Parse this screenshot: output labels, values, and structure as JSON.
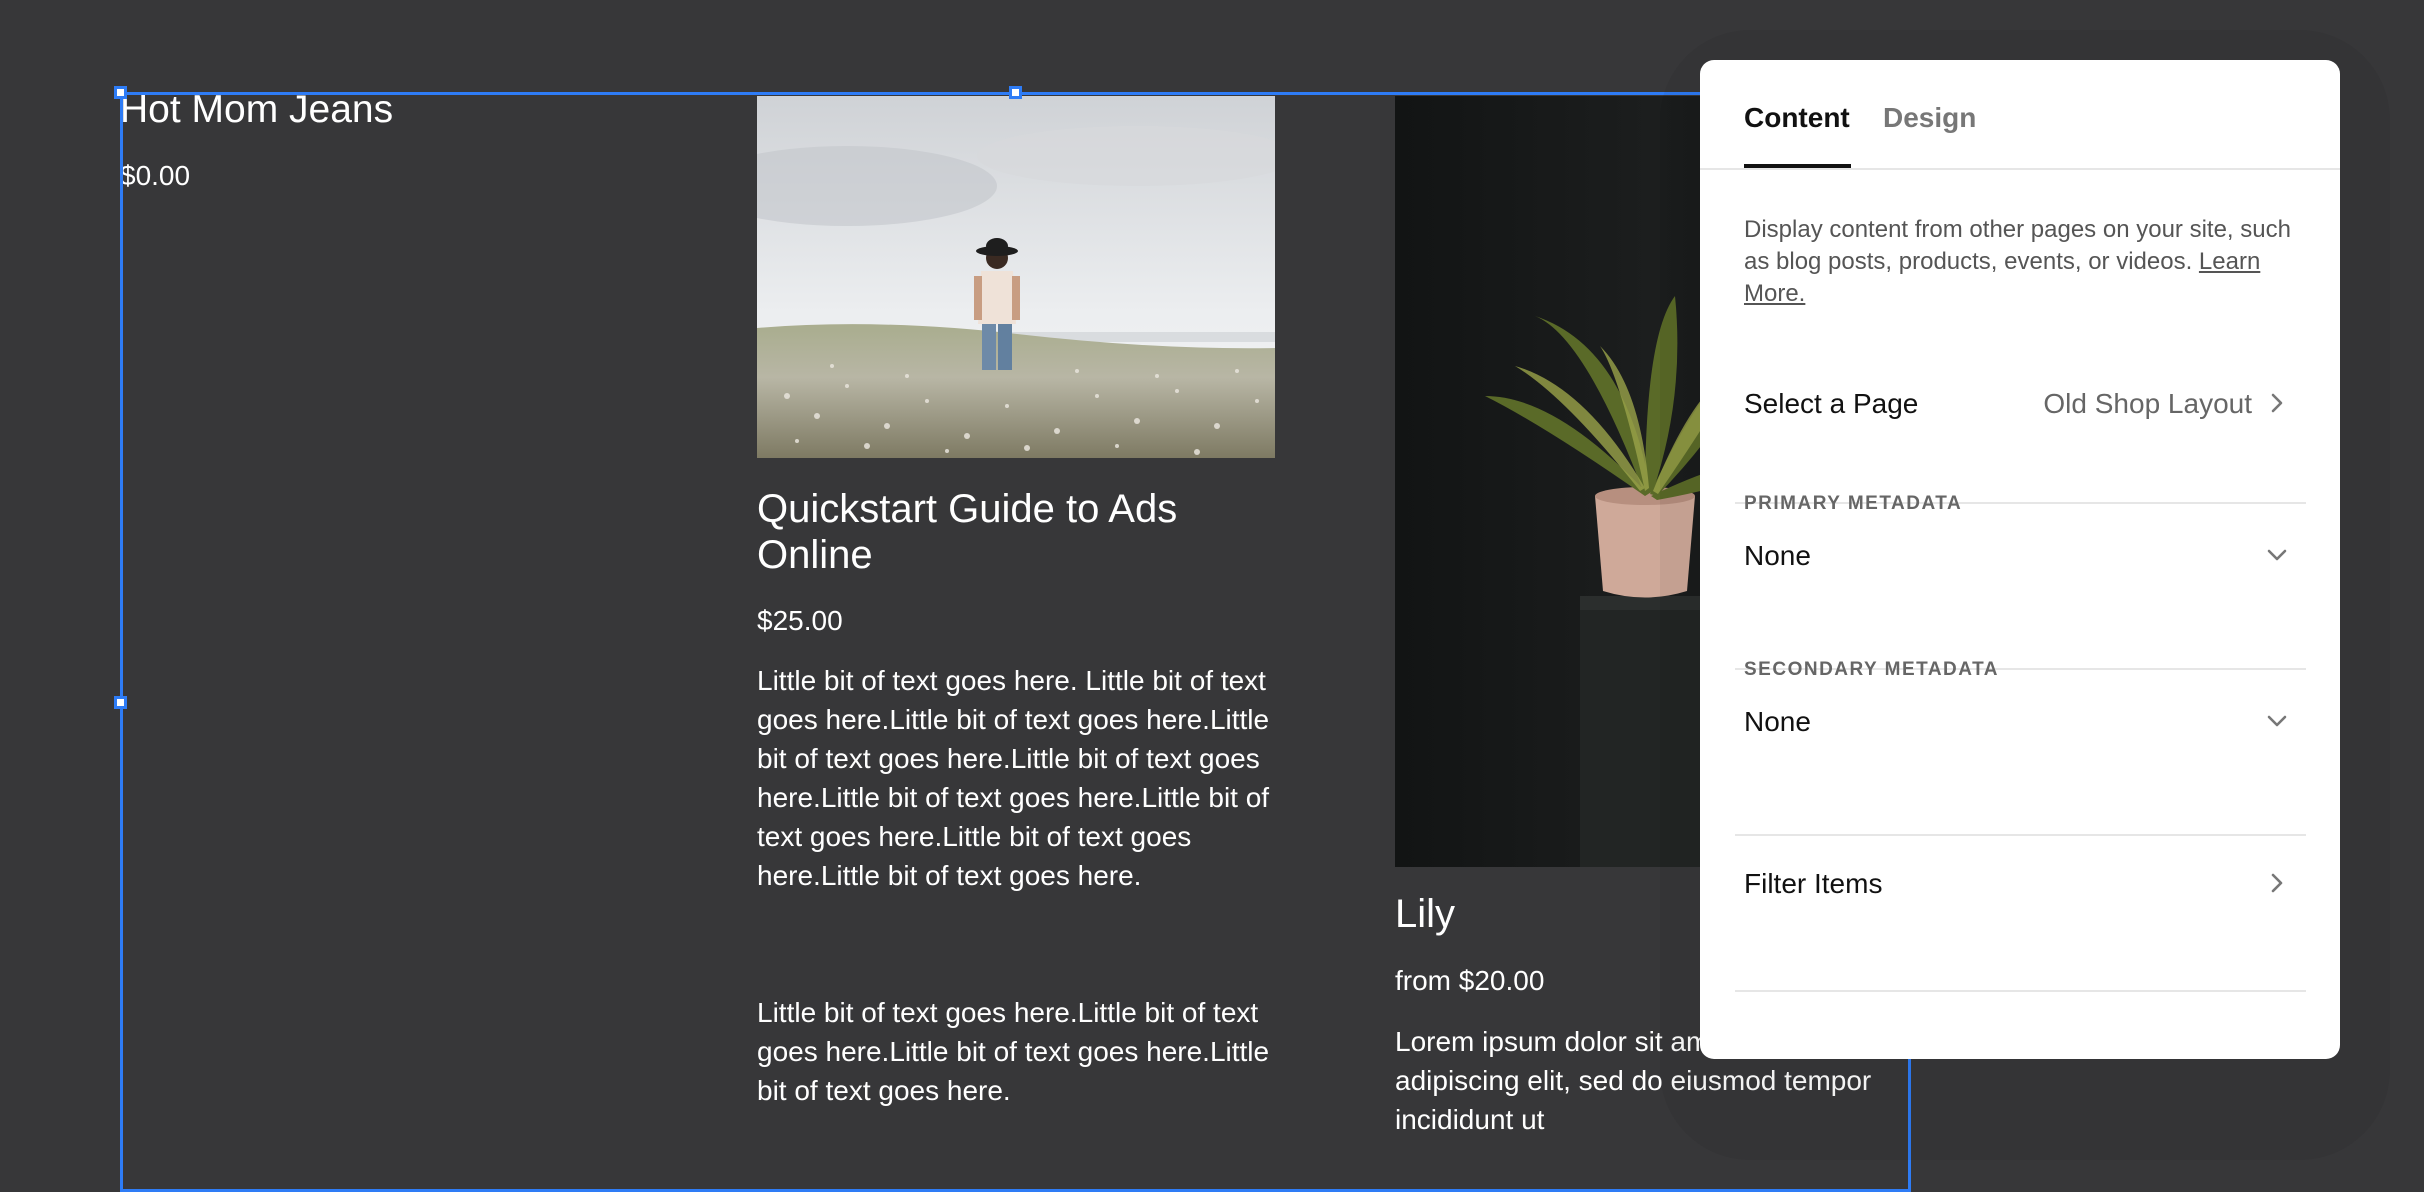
{
  "products": [
    {
      "title": "Hot Mom Jeans",
      "price": "$0.00"
    },
    {
      "title": "Quickstart Guide to Ads Online",
      "price": "$25.00",
      "description_1": "Little bit of text goes here. Little bit of text goes here.Little bit of text goes here.Little bit of text goes here.Little bit of text goes here.Little bit of text goes here.Little bit of text goes here.Little bit of text goes here.Little bit of text goes here.",
      "description_2": "Little bit of text goes here.Little bit of text goes here.Little bit of text goes here.Little bit of text goes here."
    },
    {
      "title": "Lily",
      "price": "from $20.00",
      "description": "Lorem ipsum dolor sit amet, consectetur adipiscing elit, sed do eiusmod tempor incididunt ut"
    }
  ],
  "panel": {
    "tabs": [
      {
        "label": "Content",
        "active": true
      },
      {
        "label": "Design",
        "active": false
      }
    ],
    "description": "Display content from other pages on your site, such as blog posts, products, events, or videos.",
    "learn_more": "Learn More.",
    "select_page": {
      "label": "Select a Page",
      "value": "Old Shop Layout"
    },
    "primary_metadata": {
      "label": "PRIMARY METADATA",
      "value": "None"
    },
    "secondary_metadata": {
      "label": "SECONDARY METADATA",
      "value": "None"
    },
    "filter_items": {
      "label": "Filter Items"
    }
  },
  "colors": {
    "canvas_bg": "#373739",
    "selection": "#2e7cf6",
    "panel_bg": "#ffffff"
  },
  "icons": [
    "chevron-right-icon",
    "chevron-down-icon"
  ]
}
